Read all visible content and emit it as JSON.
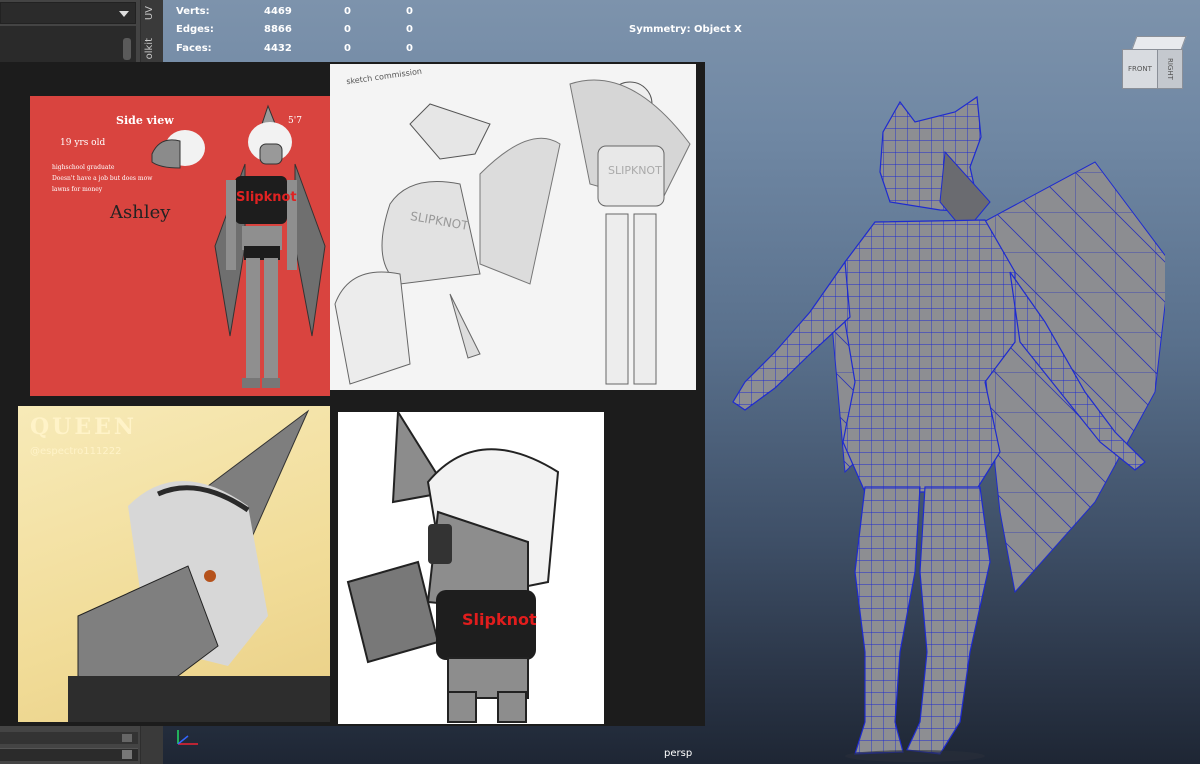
{
  "hud": {
    "rows": [
      {
        "label": "Verts:",
        "v1": "4469",
        "v2": "0",
        "v3": "0"
      },
      {
        "label": "Edges:",
        "v1": "8866",
        "v2": "0",
        "v3": "0"
      },
      {
        "label": "Faces:",
        "v1": "4432",
        "v2": "0",
        "v3": "0"
      }
    ],
    "symmetry": "Symmetry: Object X"
  },
  "viewcube": {
    "front": "FRONT",
    "right": "RIGHT"
  },
  "side_tabs": {
    "uv": "UV",
    "toolkit": "olkit"
  },
  "camera_label": "persp",
  "reference": {
    "sheet1": {
      "side_view": "Side view",
      "height": "5'7",
      "age": "19 yrs old",
      "notes": [
        "highschool graduate",
        "Doesn't have a job but does mow",
        "lawns for money"
      ],
      "name": "Ashley",
      "shirt": "Slipknot"
    },
    "sheet2": {
      "caption": "sketch commission",
      "shirt": "SLIPKNOT"
    },
    "sheet3": {
      "title": "QUEEN",
      "handle": "@espectro111222"
    },
    "sheet4": {
      "shirt": "Slipknot"
    }
  },
  "colors": {
    "viewport_top": "#7d93ac",
    "viewport_bottom": "#1e2634",
    "sheet1_bg": "#d9443f",
    "sheet3_bg": "#f3e3a8",
    "wire": "#1e2bd0",
    "mesh": "#8d8e92"
  }
}
